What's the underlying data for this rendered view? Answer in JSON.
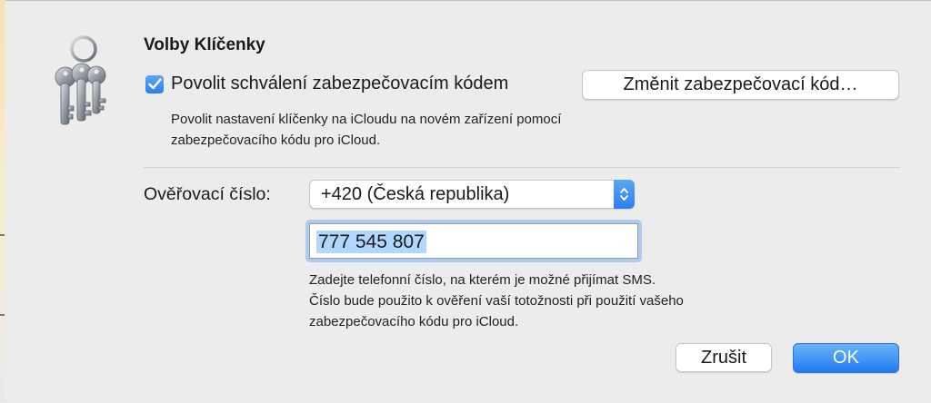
{
  "dialog": {
    "title": "Volby Klíčenky",
    "app_icon": "keys-icon",
    "approve_checkbox": {
      "checked": true,
      "label": "Povolit schválení zabezpečovacím kódem"
    },
    "change_code_label": "Změnit zabezpečovací kód…",
    "approve_description_line1": "Povolit nastavení klíčenky na iCloudu na novém zařízení pomocí",
    "approve_description_line2": "zabezpečovacího kódu pro iCloud.",
    "verify_label": "Ověřovací číslo:",
    "country_select": {
      "value": "+420 (Česká republika)"
    },
    "phone_value": "777 545 807",
    "phone_description_line1": "Zadejte telefonní číslo, na kterém je možné přijímat SMS.",
    "phone_description_line2": "Číslo bude použito k ověření vaší totožnosti při použití vašeho",
    "phone_description_line3": "zabezpečovacího kódu pro iCloud.",
    "cancel_label": "Zrušit",
    "ok_label": "OK"
  },
  "colors": {
    "accent": "#2c7ff0",
    "background": "#ececec"
  }
}
